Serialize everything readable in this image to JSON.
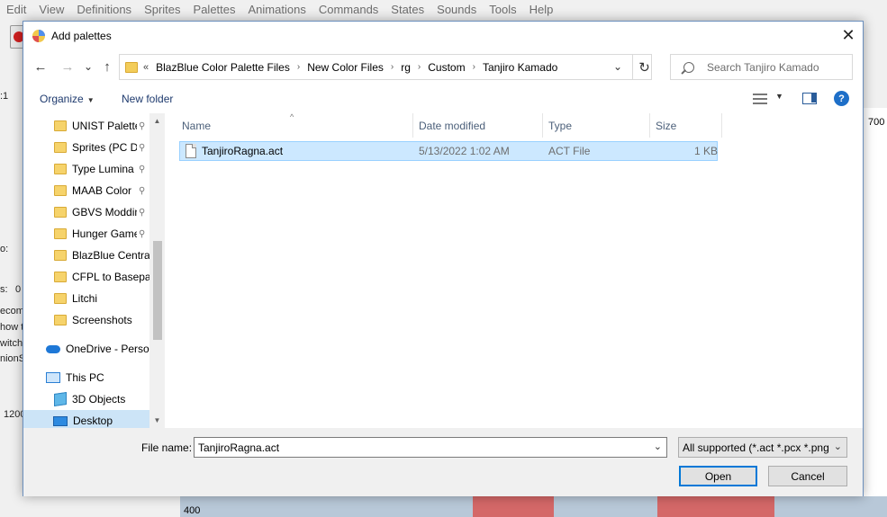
{
  "background": {
    "menu": [
      "Edit",
      "View",
      "Definitions",
      "Sprites",
      "Palettes",
      "Animations",
      "Commands",
      "States",
      "Sounds",
      "Tools",
      "Help"
    ],
    "left_fragments": [
      ":1",
      "o:",
      "s:",
      "0",
      "ecomp",
      "how t",
      "witch",
      "nionS",
      "1200"
    ],
    "right_ruler": "700",
    "bottom_ruler": "400"
  },
  "dialog": {
    "title": "Add palettes",
    "close_glyph": "✕",
    "nav": {
      "back": "←",
      "forward": "→",
      "recent": "⌄",
      "up": "↑",
      "refresh": "↻"
    },
    "address": {
      "overflow": "«",
      "segments": [
        "BlazBlue Color Palette Files",
        "New Color Files",
        "rg",
        "Custom",
        "Tanjiro Kamado"
      ],
      "dropdown": "⌄"
    },
    "search": {
      "placeholder": "Search Tanjiro Kamado"
    },
    "toolbar": {
      "organize": "Organize",
      "new_folder": "New folder",
      "caret": "▼",
      "help": "?"
    },
    "nav_pane": {
      "items": [
        {
          "label": "UNIST Palettes",
          "pinned": true
        },
        {
          "label": "Sprites (PC Dump)",
          "pinned": true
        },
        {
          "label": "Type Lumina",
          "pinned": true
        },
        {
          "label": "MAAB Color",
          "pinned": true
        },
        {
          "label": "GBVS Modding",
          "pinned": true
        },
        {
          "label": "Hunger Games",
          "pinned": true
        },
        {
          "label": "BlazBlue Central",
          "pinned": false
        },
        {
          "label": "CFPL to Basepal",
          "pinned": false
        },
        {
          "label": "Litchi",
          "pinned": false
        },
        {
          "label": "Screenshots",
          "pinned": false
        }
      ],
      "onedrive": "OneDrive - Personal",
      "this_pc": "This PC",
      "objects_3d": "3D Objects",
      "desktop": "Desktop",
      "pin_glyph": "📌"
    },
    "columns": {
      "name": "Name",
      "date": "Date modified",
      "type": "Type",
      "size": "Size",
      "sort": "^"
    },
    "files": [
      {
        "name": "TanjiroRagna.act",
        "date": "5/13/2022 1:02 AM",
        "type": "ACT File",
        "size": "1 KB"
      }
    ],
    "footer": {
      "file_name_label": "File name:",
      "file_name_value": "TanjiroRagna.act",
      "file_type": "All supported (*.act *.pcx *.png",
      "open": "Open",
      "cancel": "Cancel",
      "caret": "⌄"
    }
  }
}
